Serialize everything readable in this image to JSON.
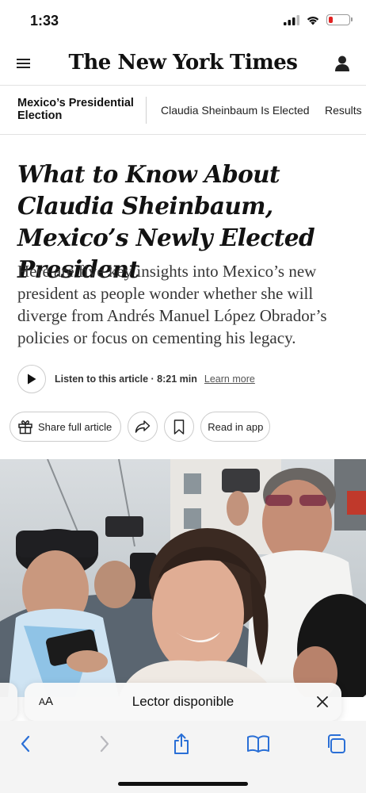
{
  "status": {
    "time": "1:33",
    "battery_level": 0.18,
    "battery_color": "#e22222",
    "icons": [
      "signal-icon",
      "wifi-icon",
      "battery-icon"
    ]
  },
  "header": {
    "masthead": "The New York Times",
    "menu_icon": "hamburger-menu-icon",
    "account_icon": "user-account-icon"
  },
  "section_nav": {
    "title": "Mexico’s Presidential Election",
    "links": [
      "Claudia Sheinbaum Is Elected",
      "Results"
    ]
  },
  "article": {
    "headline": "What to Know About Claudia Sheinbaum, Mexico’s Newly Elected President",
    "summary": "Here are five key insights into Mexico’s new president as people wonder whether she will diverge from Andrés Manuel López Obrador’s policies or focus on cementing his legacy.",
    "listen_label": "Listen to this article · 8:21 min",
    "learn_more": "Learn more",
    "share_label": "Share full article",
    "read_in_app": "Read in app"
  },
  "reader": {
    "aa_small": "A",
    "aa_large": "A",
    "label": "Lector disponible"
  },
  "toolbar": {
    "icons": [
      "back-icon",
      "forward-icon",
      "share-icon",
      "bookmarks-icon",
      "tabs-icon"
    ]
  }
}
